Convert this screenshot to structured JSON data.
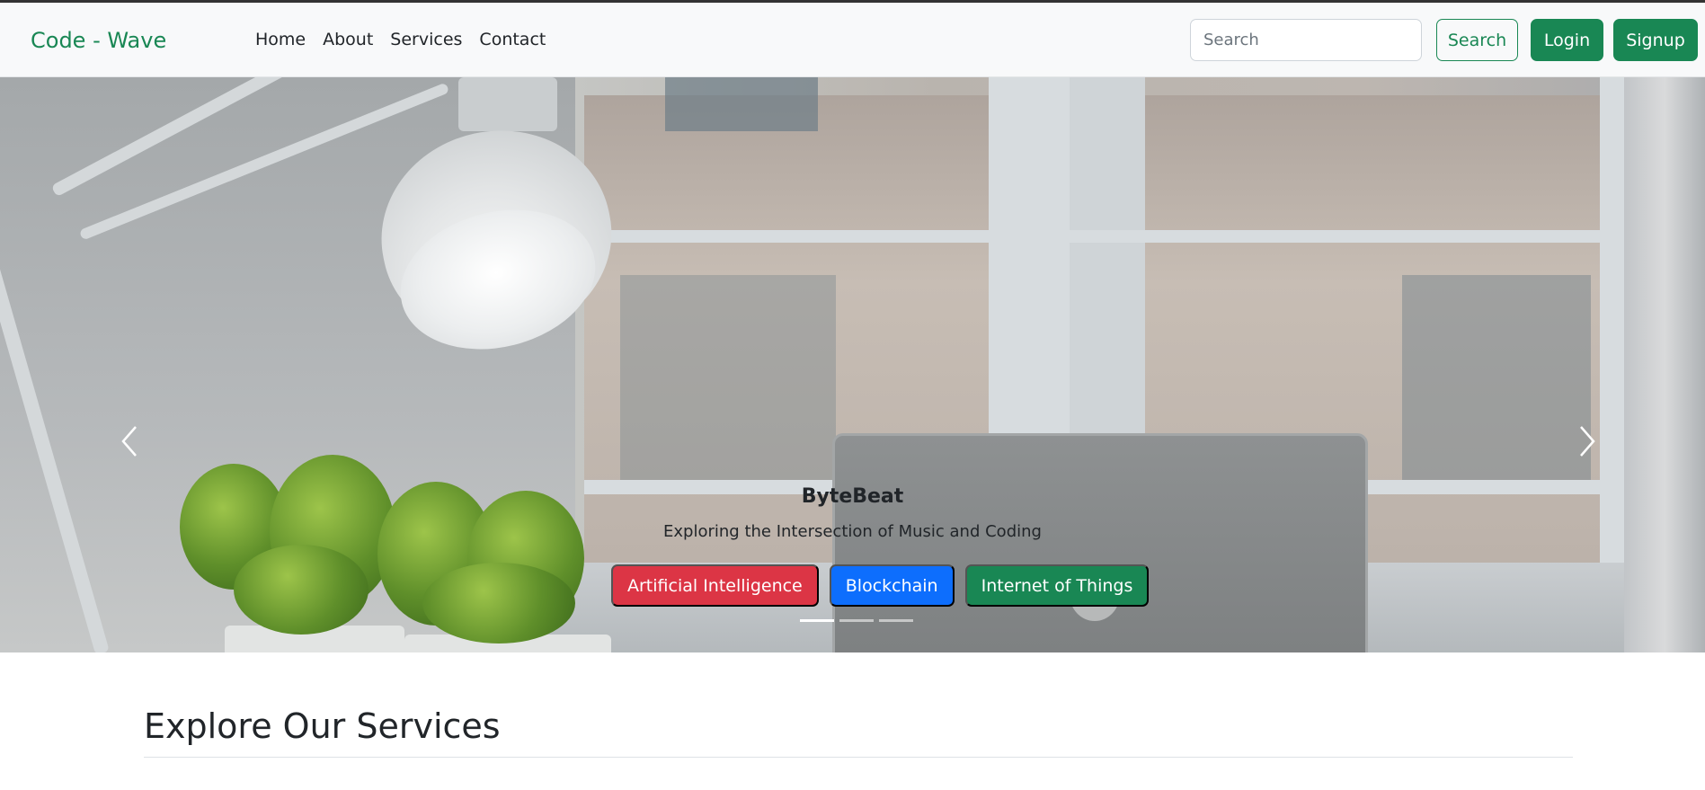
{
  "navbar": {
    "brand": "Code - Wave",
    "links": [
      "Home",
      "About",
      "Services",
      "Contact"
    ],
    "search": {
      "placeholder": "Search",
      "value": ""
    },
    "search_button": "Search",
    "login_button": "Login",
    "signup_button": "Signup"
  },
  "carousel": {
    "active_slide": 0,
    "slide_count": 3,
    "caption": {
      "title": "ByteBeat",
      "subtitle": "Exploring the Intersection of Music and Coding"
    },
    "tags": [
      {
        "label": "Artificial Intelligence",
        "color": "#dc3545"
      },
      {
        "label": "Blockchain",
        "color": "#0d6efd"
      },
      {
        "label": "Internet of Things",
        "color": "#198754"
      }
    ],
    "icons": {
      "prev": "chevron-left-icon",
      "next": "chevron-right-icon"
    }
  },
  "section": {
    "title": "Explore Our Services"
  },
  "colors": {
    "brand": "#198754",
    "danger": "#dc3545",
    "primary": "#0d6efd",
    "nav_bg": "#f8f9fa"
  }
}
